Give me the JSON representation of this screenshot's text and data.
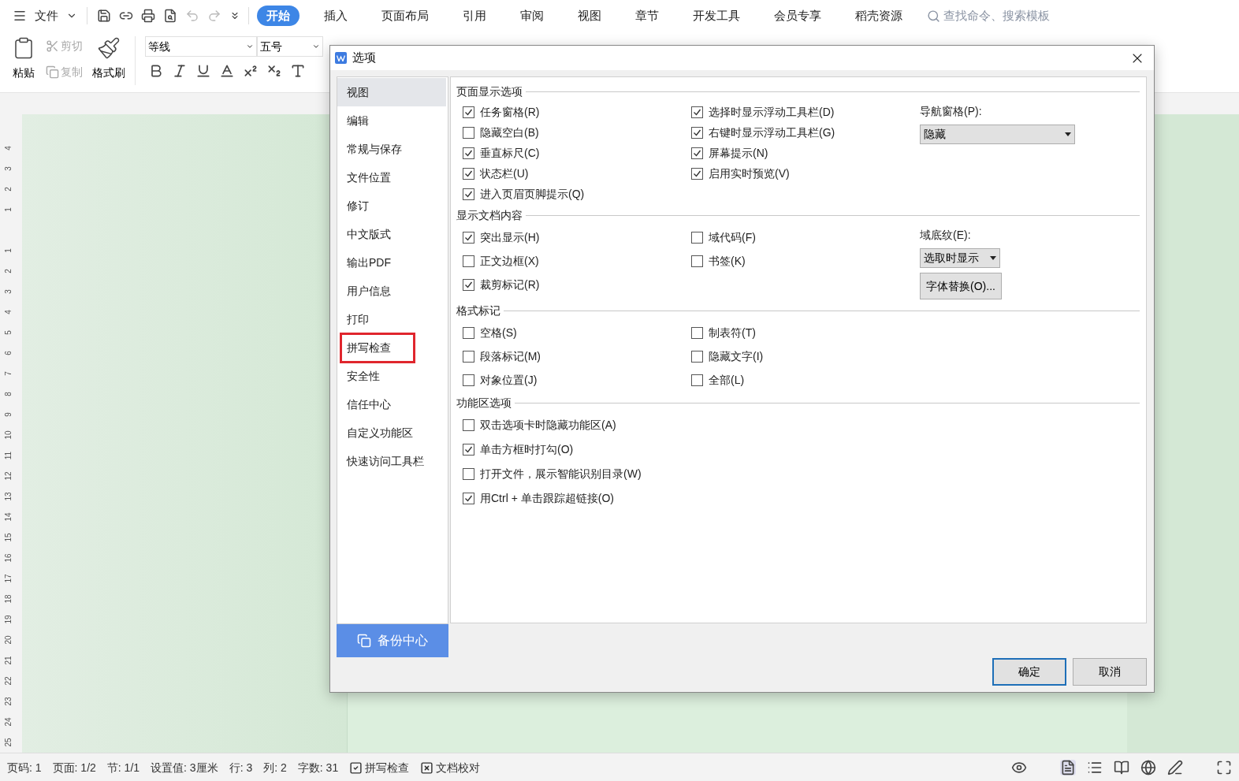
{
  "menu": {
    "file": "文件",
    "tabs": [
      {
        "label": "开始",
        "selected": true
      },
      {
        "label": "插入",
        "selected": false
      },
      {
        "label": "页面布局",
        "selected": false
      },
      {
        "label": "引用",
        "selected": false
      },
      {
        "label": "审阅",
        "selected": false
      },
      {
        "label": "视图",
        "selected": false
      },
      {
        "label": "章节",
        "selected": false
      },
      {
        "label": "开发工具",
        "selected": false
      },
      {
        "label": "会员专享",
        "selected": false
      },
      {
        "label": "稻壳资源",
        "selected": false
      }
    ],
    "search": {
      "placeholder": "查找命令、搜索模板"
    }
  },
  "ribbon": {
    "paste": "粘贴",
    "cut": {
      "label": "剪切",
      "disabled": true
    },
    "copy": {
      "label": "复制",
      "disabled": true
    },
    "format_painter": "格式刷",
    "font": "等线",
    "size": "五号"
  },
  "vertical_ruler": [
    "4",
    "3",
    "2",
    "1",
    "1",
    "2",
    "3",
    "4",
    "5",
    "6",
    "7",
    "8",
    "9",
    "10",
    "11",
    "12",
    "13",
    "14",
    "15",
    "16",
    "17",
    "18",
    "19",
    "20",
    "21",
    "22",
    "23",
    "24",
    "25"
  ],
  "dialog": {
    "title": "选项",
    "sidebar": [
      {
        "label": "视图",
        "selected": true,
        "highlighted": false
      },
      {
        "label": "编辑",
        "selected": false,
        "highlighted": false
      },
      {
        "label": "常规与保存",
        "selected": false,
        "highlighted": false
      },
      {
        "label": "文件位置",
        "selected": false,
        "highlighted": false
      },
      {
        "label": "修订",
        "selected": false,
        "highlighted": false
      },
      {
        "label": "中文版式",
        "selected": false,
        "highlighted": false
      },
      {
        "label": "输出PDF",
        "selected": false,
        "highlighted": false
      },
      {
        "label": "用户信息",
        "selected": false,
        "highlighted": false
      },
      {
        "label": "打印",
        "selected": false,
        "highlighted": false
      },
      {
        "label": "拼写检查",
        "selected": false,
        "highlighted": true
      },
      {
        "label": "安全性",
        "selected": false,
        "highlighted": false
      },
      {
        "label": "信任中心",
        "selected": false,
        "highlighted": false
      },
      {
        "label": "自定义功能区",
        "selected": false,
        "highlighted": false
      },
      {
        "label": "快速访问工具栏",
        "selected": false,
        "highlighted": false
      }
    ],
    "backup": "备份中心",
    "sections": [
      {
        "title": "页面显示选项",
        "columns": [
          [
            {
              "label": "任务窗格(R)",
              "checked": true
            },
            {
              "label": "隐藏空白(B)",
              "checked": false
            },
            {
              "label": "垂直标尺(C)",
              "checked": true
            },
            {
              "label": "状态栏(U)",
              "checked": true
            },
            {
              "label": "进入页眉页脚提示(Q)",
              "checked": true
            }
          ],
          [
            {
              "label": "选择时显示浮动工具栏(D)",
              "checked": true
            },
            {
              "label": "右键时显示浮动工具栏(G)",
              "checked": true
            },
            {
              "label": "屏幕提示(N)",
              "checked": true
            },
            {
              "label": "启用实时预览(V)",
              "checked": true
            }
          ]
        ],
        "side": [
          {
            "kind": "label",
            "text": "导航窗格(P):"
          },
          {
            "kind": "select",
            "text": "隐藏",
            "wide": true
          }
        ]
      },
      {
        "title": "显示文档内容",
        "columns": [
          [
            {
              "label": "突出显示(H)",
              "checked": true
            },
            {
              "label": "正文边框(X)",
              "checked": false
            },
            {
              "label": "裁剪标记(R)",
              "checked": true
            }
          ],
          [
            {
              "label": "域代码(F)",
              "checked": false
            },
            {
              "label": "书签(K)",
              "checked": false
            }
          ]
        ],
        "side": [
          {
            "kind": "label",
            "text": "域底纹(E):"
          },
          {
            "kind": "select",
            "text": "选取时显示",
            "wide": false
          },
          {
            "kind": "button",
            "text": "字体替换(O)..."
          }
        ]
      },
      {
        "title": "格式标记",
        "columns": [
          [
            {
              "label": "空格(S)",
              "checked": false
            },
            {
              "label": "段落标记(M)",
              "checked": false
            },
            {
              "label": "对象位置(J)",
              "checked": false
            }
          ],
          [
            {
              "label": "制表符(T)",
              "checked": false
            },
            {
              "label": "隐藏文字(I)",
              "checked": false
            },
            {
              "label": "全部(L)",
              "checked": false
            }
          ]
        ]
      },
      {
        "title": "功能区选项",
        "columns": [
          [
            {
              "label": "双击选项卡时隐藏功能区(A)",
              "checked": false
            },
            {
              "label": "单击方框时打勾(O)",
              "checked": true
            },
            {
              "label": "打开文件，展示智能识别目录(W)",
              "checked": false
            },
            {
              "label": "用Ctrl + 单击跟踪超链接(O)",
              "checked": true
            }
          ]
        ]
      }
    ],
    "buttons": [
      {
        "label": "确定",
        "default": true
      },
      {
        "label": "取消",
        "default": false
      }
    ]
  },
  "status_bar": [
    {
      "kind": "text",
      "text": "页码: 1"
    },
    {
      "kind": "text",
      "text": "页面: 1/2"
    },
    {
      "kind": "text",
      "text": "节: 1/1"
    },
    {
      "kind": "text",
      "text": "设置值: 3厘米"
    },
    {
      "kind": "text",
      "text": "行: 3"
    },
    {
      "kind": "text",
      "text": "列: 2"
    },
    {
      "kind": "text",
      "text": "字数: 31"
    },
    {
      "kind": "check",
      "text": "拼写检查"
    },
    {
      "kind": "cross",
      "text": "文档校对"
    }
  ]
}
